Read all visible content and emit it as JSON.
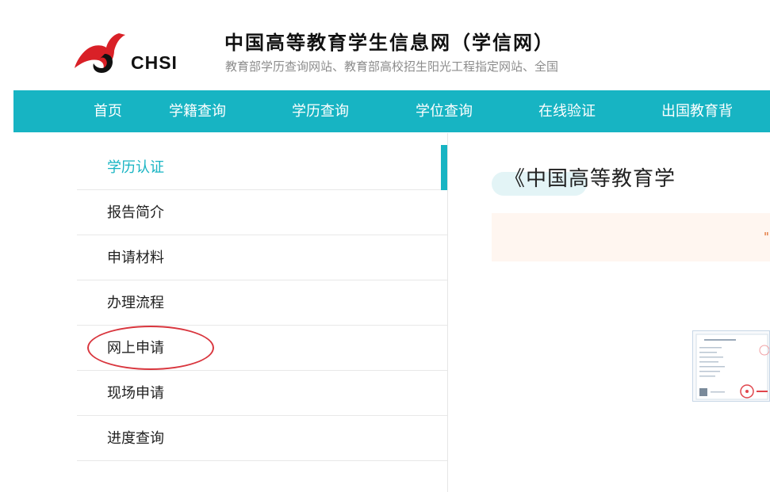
{
  "header": {
    "logo_text": "CHSI",
    "title": "中国高等教育学生信息网（学信网）",
    "subtitle": "教育部学历查询网站、教育部高校招生阳光工程指定网站、全国"
  },
  "nav": {
    "items": [
      "首页",
      "学籍查询",
      "学历查询",
      "学位查询",
      "在线验证",
      "出国教育背"
    ]
  },
  "sidebar": {
    "items": [
      {
        "label": "学历认证"
      },
      {
        "label": "报告简介"
      },
      {
        "label": "申请材料"
      },
      {
        "label": "办理流程"
      },
      {
        "label": "网上申请"
      },
      {
        "label": "现场申请"
      },
      {
        "label": "进度查询"
      }
    ]
  },
  "main": {
    "title": "《中国高等教育学",
    "notice_fragment": "\""
  },
  "colors": {
    "accent": "#17b4c3",
    "annotation": "#d9363e",
    "notice_bg": "#fff6f0"
  }
}
